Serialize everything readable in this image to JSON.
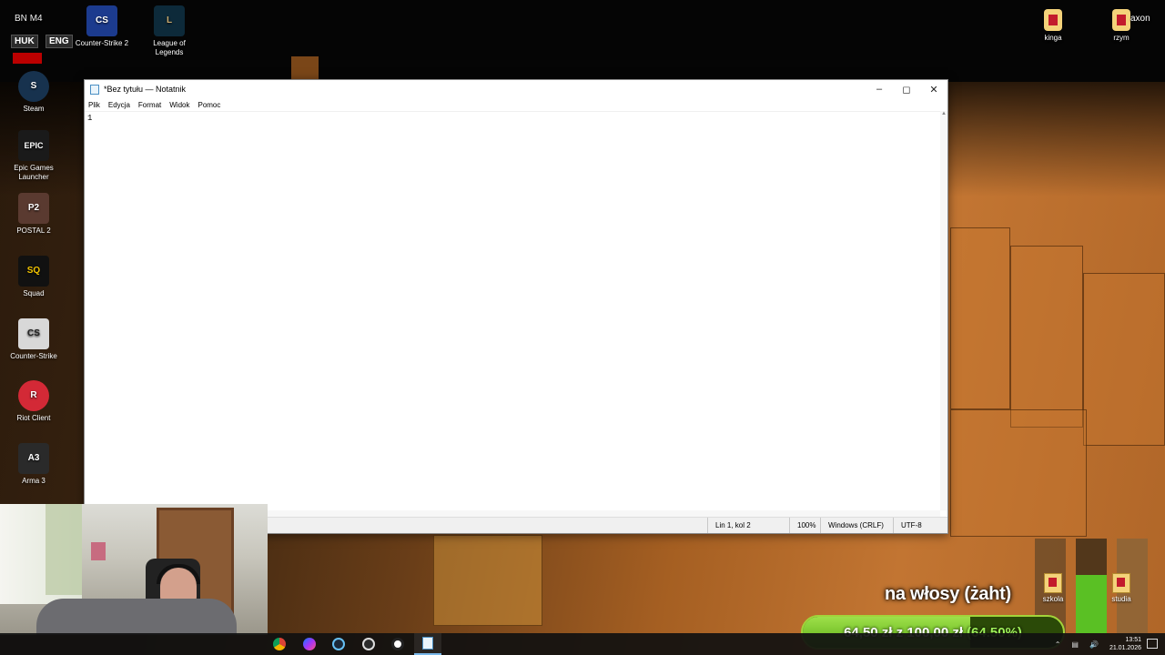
{
  "desktop": {
    "icons_left": [
      {
        "label": "Steam",
        "icon": "steam-icon"
      },
      {
        "label": "Epic Games Launcher",
        "icon": "epic-games-icon"
      },
      {
        "label": "POSTAL 2",
        "icon": "postal2-icon"
      },
      {
        "label": "Squad",
        "icon": "squad-icon"
      },
      {
        "label": "Counter-Strike",
        "icon": "counter-strike-icon"
      },
      {
        "label": "Riot Client",
        "icon": "riot-client-icon"
      },
      {
        "label": "Arma 3",
        "icon": "arma3-icon"
      }
    ],
    "icons_top": [
      {
        "label": "Counter-Strike 2",
        "icon": "cs2-icon"
      },
      {
        "label": "League of Legends",
        "icon": "lol-icon"
      }
    ],
    "icons_right": [
      {
        "label": "kinga",
        "icon": "folder-icon"
      },
      {
        "label": "rzym",
        "icon": "folder-icon"
      }
    ],
    "top_right_label": "axon",
    "overlay_badges": [
      "HUK",
      "ENG"
    ],
    "overlay_top_text": "BN",
    "overlay_top_text2": "M4"
  },
  "notepad": {
    "title": "*Bez tytułu — Notatnik",
    "menu": [
      "Plik",
      "Edycja",
      "Format",
      "Widok",
      "Pomoc"
    ],
    "content": "1",
    "status": {
      "position": "Lin 1, kol 2",
      "zoom": "100%",
      "line_endings": "Windows (CRLF)",
      "encoding": "UTF-8"
    }
  },
  "stream_overlay": {
    "donation_text": "na włosy (żaht)",
    "goal_current": "64,50 zł",
    "goal_separator": "z",
    "goal_target": "100,00 zł",
    "goal_percent": "(64.50%)",
    "goal_fraction": 0.645,
    "folders": [
      {
        "label": "szkola"
      },
      {
        "label": "studia"
      }
    ]
  },
  "taskbar": {
    "apps": [
      "chrome-icon",
      "messenger-icon",
      "steam-icon",
      "obs-icon",
      "app-icon",
      "notepad-icon"
    ],
    "time": "13:51",
    "date": "21.01.2026"
  },
  "colors": {
    "goal_fill": "#5caf16",
    "taskbar_active": "#7ab8ea"
  }
}
